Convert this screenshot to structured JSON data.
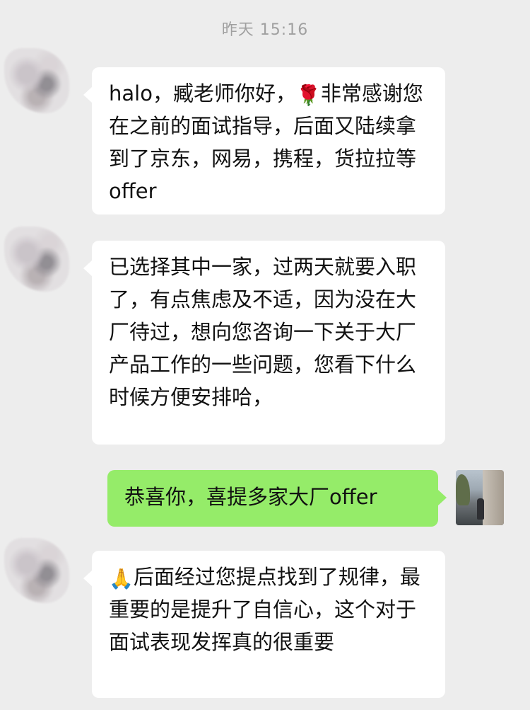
{
  "timestamp": "昨天 15:16",
  "messages": [
    {
      "side": "left",
      "text_before_emoji": "halo，臧老师你好，",
      "emoji": "rose-icon",
      "emoji_glyph": "🌹",
      "text_after_emoji": "非常感谢您在之前的面试指导，后面又陆续拿到了京东，网易，携程，货拉拉等offer"
    },
    {
      "side": "left",
      "text": "已选择其中一家，过两天就要入职了，有点焦虑及不适，因为没在大厂待过，想向您咨询一下关于大厂产品工作的一些问题，您看下什么时候方便安排哈，"
    },
    {
      "side": "right",
      "text": "恭喜你，喜提多家大厂offer"
    },
    {
      "side": "left",
      "emoji": "praise-icon",
      "emoji_glyph": "🙏",
      "text_after_emoji": "后面经过您提点找到了规律，最重要的是提升了自信心，这个对于面试表现发挥真的很重要"
    }
  ],
  "colors": {
    "background": "#ededed",
    "incoming_bubble": "#ffffff",
    "outgoing_bubble": "#95ec69",
    "timestamp_text": "#a0a0a0"
  }
}
